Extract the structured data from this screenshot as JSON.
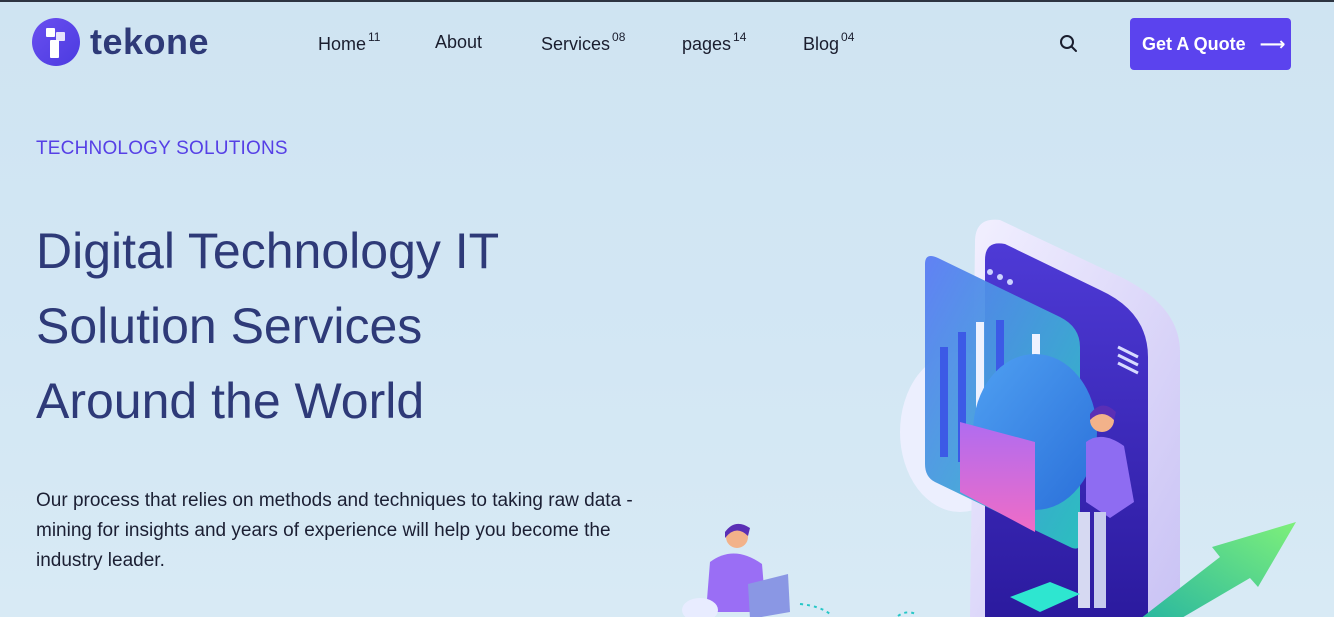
{
  "brand": {
    "name": "tekone"
  },
  "nav": {
    "items": [
      {
        "label": "Home",
        "badge": "11"
      },
      {
        "label": "About",
        "badge": ""
      },
      {
        "label": "Services",
        "badge": "08"
      },
      {
        "label": "pages",
        "badge": "14"
      },
      {
        "label": "Blog",
        "badge": "04"
      }
    ]
  },
  "header": {
    "search_icon": "search-icon",
    "cta_label": "Get A Quote",
    "cta_arrow": "⟶"
  },
  "hero": {
    "eyebrow": "TECHNOLOGY SOLUTIONS",
    "title_lines": [
      "Digital Technology IT",
      "Solution Services",
      "Around the World"
    ],
    "description": "Our process that relies on methods and techniques to taking raw data - mining for insights and years of experience will help you become the industry leader."
  },
  "colors": {
    "accent": "#5b43ee",
    "heading": "#2e3a78",
    "background": "#cfe4f2"
  }
}
